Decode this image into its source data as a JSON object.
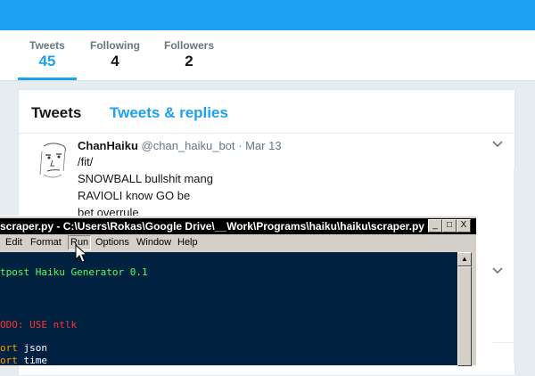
{
  "profile_nav": {
    "items": [
      {
        "label": "Tweets",
        "value": "45",
        "active": true
      },
      {
        "label": "Following",
        "value": "4",
        "active": false
      },
      {
        "label": "Followers",
        "value": "2",
        "active": false
      }
    ]
  },
  "timeline": {
    "tabs": [
      {
        "label": "Tweets"
      },
      {
        "label": "Tweets & replies"
      }
    ],
    "tweet": {
      "name": "ChanHaiku",
      "handle": "@chan_haiku_bot",
      "date": "· Mar 13",
      "lines": [
        "/fit/",
        "SNOWBALL bullshit mang",
        "RAVIOLI know GO be",
        "bet overrule"
      ]
    }
  },
  "idle_window": {
    "title": "scraper.py - C:\\Users\\Rokas\\Google Drive\\__Work\\Programs\\haiku\\haiku\\scraper.py (2...",
    "buttons": {
      "minimize": "_",
      "maximize": "□",
      "close": "X"
    },
    "menu": [
      "Edit",
      "Format",
      "Run",
      "Options",
      "Window",
      "Help"
    ],
    "code": [
      {
        "text": "tpost Haiku Generator 0.1",
        "kind": "green"
      },
      {
        "text": "ODO: USE ntlk",
        "kind": "red"
      },
      {
        "prefix": "ort",
        "rest": " json"
      },
      {
        "prefix": "ort",
        "rest": " time"
      }
    ]
  },
  "colors": {
    "twitter_blue": "#1da1f2",
    "editor_bg": "#002240"
  },
  "icons": [
    "caret-down-icon",
    "avatar-face-icon",
    "mouse-pointer-icon"
  ]
}
